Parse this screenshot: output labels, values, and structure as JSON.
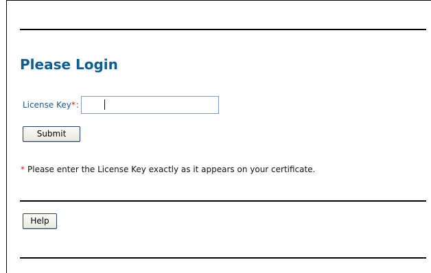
{
  "login": {
    "title": "Please Login",
    "license_label": "License Key",
    "required_marker": "*",
    "label_colon": ":",
    "license_value": "",
    "submit_label": "Submit"
  },
  "footnote": {
    "marker": "*",
    "text": "Please enter the License Key exactly as it appears on your certificate."
  },
  "help": {
    "label": "Help"
  },
  "colors": {
    "title": "#0b5d8f",
    "label": "#1a5a92",
    "required": "#d41818",
    "rule": "#000000",
    "input_border": "#7f9db9"
  }
}
